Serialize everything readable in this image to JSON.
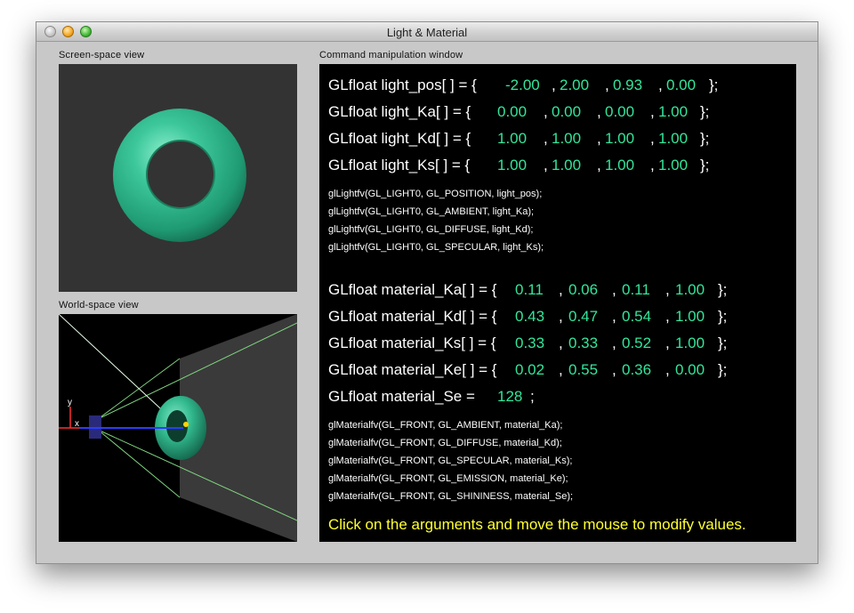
{
  "window": {
    "title": "Light & Material"
  },
  "screen_view": {
    "label": "Screen-space view",
    "torus_color": "#3cc79a"
  },
  "world_view": {
    "label": "World-space view",
    "axis_labels": {
      "x": "x",
      "y": "y"
    }
  },
  "command_window": {
    "label": "Command manipulation window",
    "light": [
      {
        "prefix": "GLfloat light_pos[ ] = {",
        "values": [
          "-2.00",
          "2.00",
          "0.93",
          "0.00"
        ]
      },
      {
        "prefix": "GLfloat light_Ka[ ] = {",
        "values": [
          "0.00",
          "0.00",
          "0.00",
          "1.00"
        ]
      },
      {
        "prefix": "GLfloat light_Kd[ ] = {",
        "values": [
          "1.00",
          "1.00",
          "1.00",
          "1.00"
        ]
      },
      {
        "prefix": "GLfloat light_Ks[ ] = {",
        "values": [
          "1.00",
          "1.00",
          "1.00",
          "1.00"
        ]
      }
    ],
    "light_calls": [
      "glLightfv(GL_LIGHT0, GL_POSITION, light_pos);",
      "glLightfv(GL_LIGHT0, GL_AMBIENT, light_Ka);",
      "glLightfv(GL_LIGHT0, GL_DIFFUSE, light_Kd);",
      "glLightfv(GL_LIGHT0, GL_SPECULAR, light_Ks);"
    ],
    "material": [
      {
        "prefix": "GLfloat material_Ka[ ] = {",
        "values": [
          "0.11",
          "0.06",
          "0.11",
          "1.00"
        ]
      },
      {
        "prefix": "GLfloat material_Kd[ ] = {",
        "values": [
          "0.43",
          "0.47",
          "0.54",
          "1.00"
        ]
      },
      {
        "prefix": "GLfloat material_Ks[ ] = {",
        "values": [
          "0.33",
          "0.33",
          "0.52",
          "1.00"
        ]
      },
      {
        "prefix": "GLfloat material_Ke[ ] = {",
        "values": [
          "0.02",
          "0.55",
          "0.36",
          "0.00"
        ]
      }
    ],
    "shininess": {
      "prefix": "GLfloat material_Se =",
      "value": "128",
      "suffix": ";"
    },
    "material_calls": [
      "glMaterialfv(GL_FRONT, GL_AMBIENT, material_Ka);",
      "glMaterialfv(GL_FRONT, GL_DIFFUSE, material_Kd);",
      "glMaterialfv(GL_FRONT, GL_SPECULAR, material_Ks);",
      "glMaterialfv(GL_FRONT, GL_EMISSION, material_Ke);",
      "glMaterialfv(GL_FRONT, GL_SHININESS, material_Se);"
    ],
    "comma": ",",
    "closing": "};",
    "hint": "Click on the arguments and move the mouse to modify values."
  },
  "colors": {
    "value_green": "#33e69a",
    "hint_yellow": "#ffff33"
  }
}
